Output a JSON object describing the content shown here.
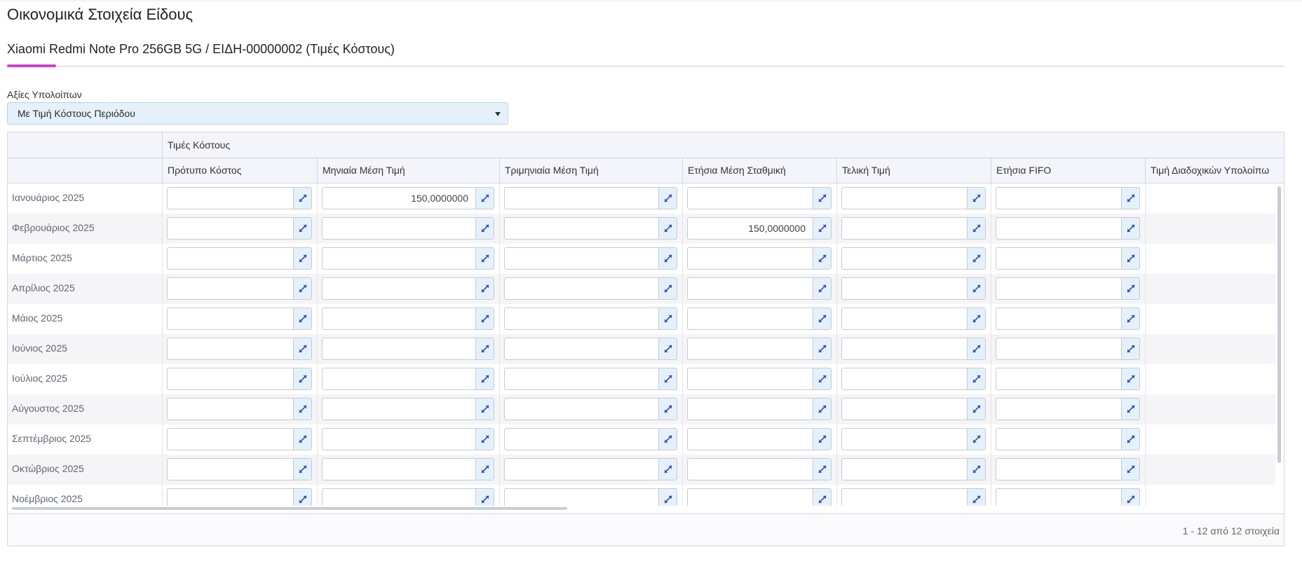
{
  "page": {
    "title": "Οικονομικά Στοιχεία Είδους",
    "subtitle": "Xiaomi Redmi Note Pro 256GB 5G / ΕΙΔΗ-00000002 (Τιμές Κόστους)"
  },
  "filter": {
    "label": "Αξίες Υπολοίπων",
    "selected": "Με Τιμή Κόστους Περιόδου"
  },
  "grid": {
    "group_header": "Τιμές Κόστους",
    "columns": [
      "Πρότυπο Κόστος",
      "Μηνιαία Μέση Τιμή",
      "Τριμηνιαία Μέση Τιμή",
      "Ετήσια Μέση Σταθμική",
      "Τελική Τιμή",
      "Ετήσια FIFO",
      "Τιμή Διαδοχικών Υπολοίπω"
    ],
    "rows": [
      {
        "label": "Ιανουάριος 2025",
        "values": [
          "",
          "150,0000000",
          "",
          "",
          "",
          ""
        ]
      },
      {
        "label": "Φεβρουάριος 2025",
        "values": [
          "",
          "",
          "",
          "150,0000000",
          "",
          ""
        ]
      },
      {
        "label": "Μάρτιος 2025",
        "values": [
          "",
          "",
          "",
          "",
          "",
          ""
        ]
      },
      {
        "label": "Απρίλιος 2025",
        "values": [
          "",
          "",
          "",
          "",
          "",
          ""
        ]
      },
      {
        "label": "Μάιος 2025",
        "values": [
          "",
          "",
          "",
          "",
          "",
          ""
        ]
      },
      {
        "label": "Ιούνιος 2025",
        "values": [
          "",
          "",
          "",
          "",
          "",
          ""
        ]
      },
      {
        "label": "Ιούλιος 2025",
        "values": [
          "",
          "",
          "",
          "",
          "",
          ""
        ]
      },
      {
        "label": "Αύγουστος 2025",
        "values": [
          "",
          "",
          "",
          "",
          "",
          ""
        ]
      },
      {
        "label": "Σεπτέμβριος 2025",
        "values": [
          "",
          "",
          "",
          "",
          "",
          ""
        ]
      },
      {
        "label": "Οκτώβριος 2025",
        "values": [
          "",
          "",
          "",
          "",
          "",
          ""
        ]
      },
      {
        "label": "Νοέμβριος 2025",
        "values": [
          "",
          "",
          "",
          "",
          "",
          ""
        ]
      }
    ],
    "footer_info": "1 - 12 από 12 στοιχεία"
  },
  "colors": {
    "accent_tab": "#d63ecb",
    "input_button_bg": "#e4f1fb",
    "icon": "#3a4fb8"
  },
  "icons": {
    "expand_button": "expand-arrows-icon",
    "dropdown": "chevron-down-icon"
  }
}
